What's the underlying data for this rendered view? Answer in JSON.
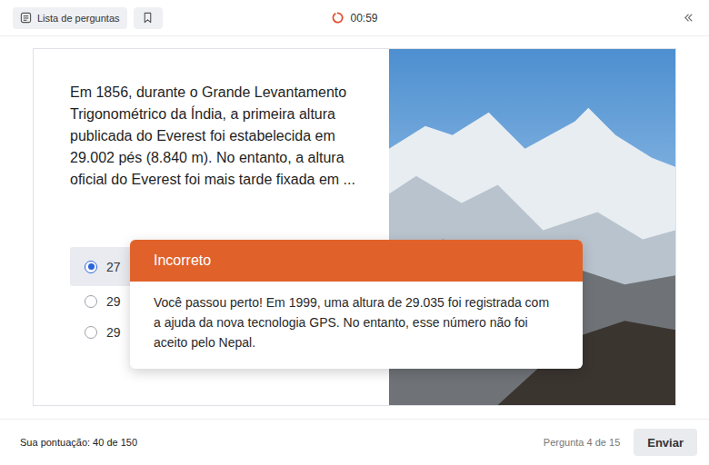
{
  "toolbar": {
    "questions_button": "Lista de perguntas",
    "timer": "00:59"
  },
  "question": {
    "text": "Em 1856, durante o Grande Levantamento Trigonométrico da Índia, a primeira altura publicada do Everest foi estabelecida em 29.002 pés (8.840 m). No entanto, a altura oficial do Everest foi mais tarde fixada em ...",
    "options": [
      {
        "label": "27",
        "selected": true
      },
      {
        "label": "29",
        "selected": false
      },
      {
        "label": "29",
        "selected": false
      }
    ]
  },
  "feedback": {
    "title": "Incorreto",
    "message": "Você passou perto! Em 1999, uma altura de 29.035 foi registrada com a ajuda da nova tecnologia GPS. No entanto, esse número não foi aceito pelo Nepal."
  },
  "footer": {
    "score": "Sua pontuação: 40 de 150",
    "progress": "Pergunta 4 de 15",
    "submit": "Enviar"
  }
}
